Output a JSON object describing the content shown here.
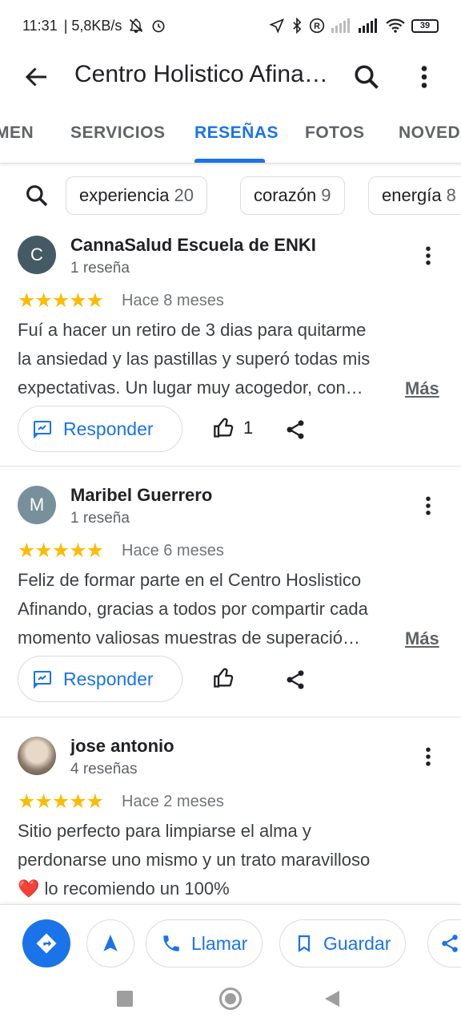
{
  "status_bar": {
    "time": "11:31",
    "speed": "| 5,8KB/s",
    "battery": "39"
  },
  "app_bar": {
    "title": "Centro Holistico Afinando"
  },
  "tabs": [
    {
      "label": "MEN",
      "active": false
    },
    {
      "label": "SERVICIOS",
      "active": false
    },
    {
      "label": "RESEÑAS",
      "active": true
    },
    {
      "label": "FOTOS",
      "active": false
    },
    {
      "label": "NOVEDADES",
      "active": false
    }
  ],
  "chips": [
    {
      "label": "experiencia",
      "count": "20"
    },
    {
      "label": "corazón",
      "count": "9"
    },
    {
      "label": "energía",
      "count": "8"
    }
  ],
  "reviews": [
    {
      "avatar_letter": "C",
      "avatar_color": "#455a64",
      "name": "CannaSalud Escuela de ENKI",
      "count": "1 reseña",
      "stars": "★★★★★",
      "date": "Hace 8 meses",
      "lines": [
        "Fuí a hacer un retiro de 3 dias para quitarme",
        "la ansiedad y las pastillas y superó todas mis",
        "expectativas. Un lugar muy acogedor, con…"
      ],
      "more": "Más",
      "reply": "Responder",
      "likes": "1"
    },
    {
      "avatar_letter": "M",
      "avatar_color": "#78909c",
      "name": "Maribel Guerrero",
      "count": "1 reseña",
      "stars": "★★★★★",
      "date": "Hace 6 meses",
      "lines": [
        "Feliz de formar parte en el Centro Hoslistico",
        "Afinando, gracias a todos por compartir cada",
        "momento valiosas muestras de superació…"
      ],
      "more": "Más",
      "reply": "Responder",
      "likes": ""
    },
    {
      "avatar_letter": "",
      "avatar_color": "#b0a090",
      "name": "jose antonio",
      "count": "4 reseñas",
      "stars": "★★★★★",
      "date": "Hace 2 meses",
      "lines": [
        "Sitio perfecto para limpiarse el alma y",
        "perdonarse uno mismo y un trato maravilloso",
        "❤️ lo recomiendo un 100%"
      ]
    }
  ],
  "actions": {
    "call": "Llamar",
    "save": "Guardar"
  },
  "colors": {
    "accent": "#1a73e8",
    "star": "#fbbc04"
  }
}
